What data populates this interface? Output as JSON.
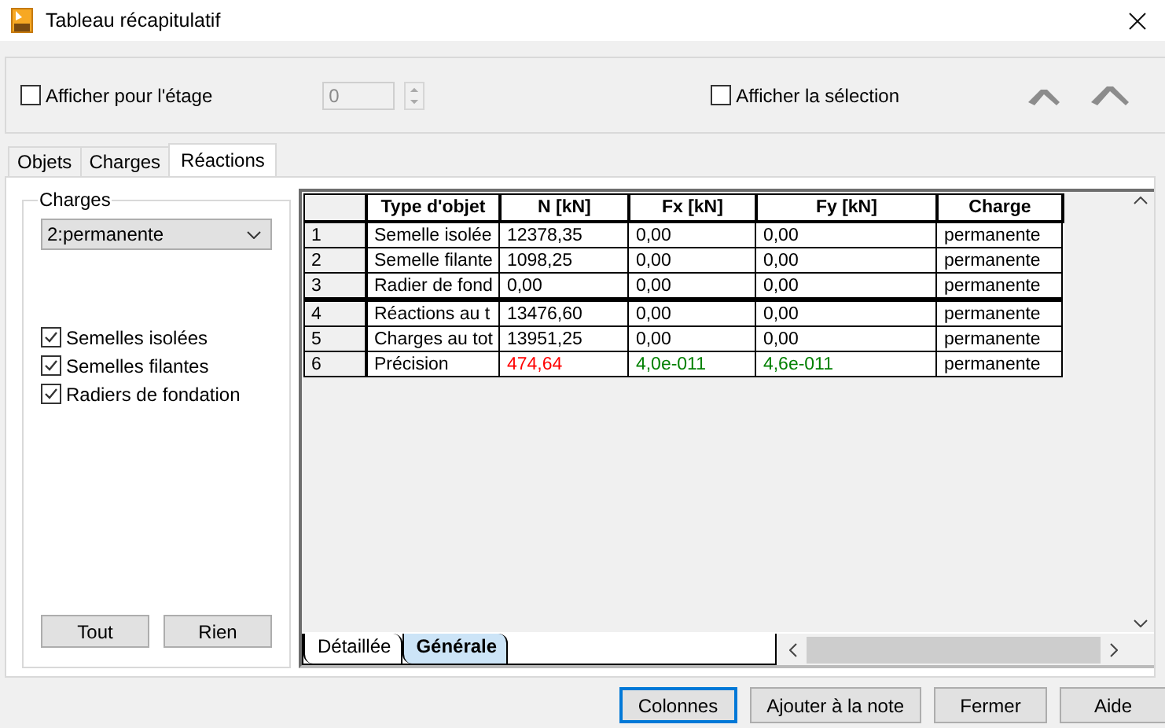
{
  "window": {
    "title": "Tableau récapitulatif"
  },
  "floor_filter": {
    "label": "Afficher pour l'étage",
    "checked": false,
    "value": "0",
    "disabled": true
  },
  "show_selection": {
    "label": "Afficher la sélection",
    "checked": false
  },
  "tabs": [
    {
      "label": "Objets",
      "selected": false
    },
    {
      "label": "Charges",
      "selected": false
    },
    {
      "label": "Réactions",
      "selected": true
    }
  ],
  "charges": {
    "legend": "Charges",
    "dropdown": "2:permanente",
    "options": [
      {
        "label": "Semelles isolées",
        "checked": true
      },
      {
        "label": "Semelles filantes",
        "checked": true
      },
      {
        "label": "Radiers de fondation",
        "checked": true
      }
    ],
    "buttons": [
      "Tout",
      "Rien"
    ]
  },
  "table": {
    "columns": [
      "Type d'objet",
      "N [kN]",
      "Fx [kN]",
      "Fy [kN]",
      "Charge"
    ],
    "rows": [
      {
        "number": "1",
        "separator_above": false,
        "cells": [
          {
            "text": "Semelle isolée"
          },
          {
            "text": "12378,35"
          },
          {
            "text": "0,00"
          },
          {
            "text": "0,00"
          },
          {
            "text": "permanente"
          }
        ]
      },
      {
        "number": "2",
        "separator_above": false,
        "cells": [
          {
            "text": "Semelle filante"
          },
          {
            "text": "1098,25"
          },
          {
            "text": "0,00"
          },
          {
            "text": "0,00"
          },
          {
            "text": "permanente"
          }
        ]
      },
      {
        "number": "3",
        "separator_above": false,
        "cells": [
          {
            "text": "Radier de fond"
          },
          {
            "text": "0,00"
          },
          {
            "text": "0,00"
          },
          {
            "text": "0,00"
          },
          {
            "text": "permanente"
          }
        ]
      },
      {
        "number": "4",
        "separator_above": true,
        "cells": [
          {
            "text": "Réactions au t"
          },
          {
            "text": "13476,60"
          },
          {
            "text": "0,00"
          },
          {
            "text": "0,00"
          },
          {
            "text": "permanente"
          }
        ]
      },
      {
        "number": "5",
        "separator_above": false,
        "cells": [
          {
            "text": "Charges au tot"
          },
          {
            "text": "13951,25"
          },
          {
            "text": "0,00"
          },
          {
            "text": "0,00"
          },
          {
            "text": "permanente"
          }
        ]
      },
      {
        "number": "6",
        "separator_above": false,
        "cells": [
          {
            "text": "Précision"
          },
          {
            "text": "474,64",
            "color": "#ff0000"
          },
          {
            "text": "4,0e-011",
            "color": "#008000"
          },
          {
            "text": "4,6e-011",
            "color": "#008000"
          },
          {
            "text": "permanente"
          }
        ]
      }
    ]
  },
  "sheet_tabs": [
    {
      "label": "Détaillée",
      "selected": false
    },
    {
      "label": "Générale",
      "selected": true
    }
  ],
  "buttons": [
    {
      "label": "Colonnes",
      "default": true
    },
    {
      "label": "Ajouter à la note",
      "default": false
    },
    {
      "label": "Fermer",
      "default": false
    },
    {
      "label": "Aide",
      "default": false
    }
  ]
}
